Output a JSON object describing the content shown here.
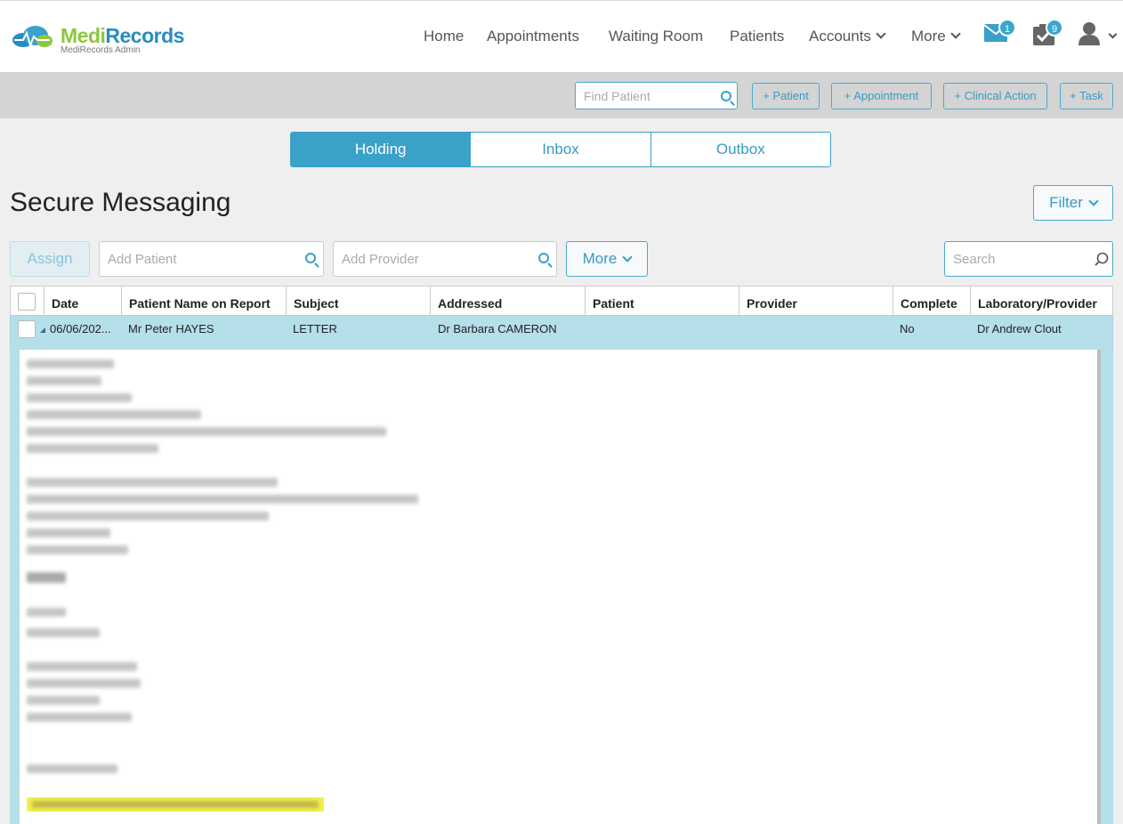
{
  "app": {
    "brand_medi": "Medi",
    "brand_records": "Records",
    "subtitle": "MediRecords Admin"
  },
  "nav": {
    "home": "Home",
    "appointments": "Appointments",
    "waiting_room": "Waiting Room",
    "patients": "Patients",
    "accounts": "Accounts",
    "more": "More",
    "mail_badge": "1",
    "tasks_badge": "9"
  },
  "toolbar": {
    "find_patient_placeholder": "Find Patient",
    "add_patient": "+ Patient",
    "add_appointment": "+ Appointment",
    "add_clinical_action": "+ Clinical Action",
    "add_task": "+ Task"
  },
  "tabs": [
    {
      "label": "Holding",
      "active": true
    },
    {
      "label": "Inbox",
      "active": false
    },
    {
      "label": "Outbox",
      "active": false
    }
  ],
  "page": {
    "title": "Secure Messaging",
    "filter": "Filter"
  },
  "actions": {
    "assign": "Assign",
    "add_patient_placeholder": "Add Patient",
    "add_provider_placeholder": "Add Provider",
    "more": "More",
    "search_placeholder": "Search"
  },
  "table": {
    "columns": [
      "Date",
      "Patient Name on Report",
      "Subject",
      "Addressed",
      "Patient",
      "Provider",
      "Complete",
      "Laboratory/Provider"
    ],
    "rows": [
      {
        "date": "06/06/202...",
        "patient_name": "Mr Peter HAYES",
        "subject": "LETTER",
        "addressed": "Dr Barbara CAMERON",
        "patient": "",
        "provider": "",
        "complete": "No",
        "lab_provider": "Dr Andrew Clout"
      }
    ]
  },
  "colors": {
    "accent": "#3aa1c8",
    "selected_row": "#b5dfe9",
    "highlight": "#f4f14a"
  }
}
